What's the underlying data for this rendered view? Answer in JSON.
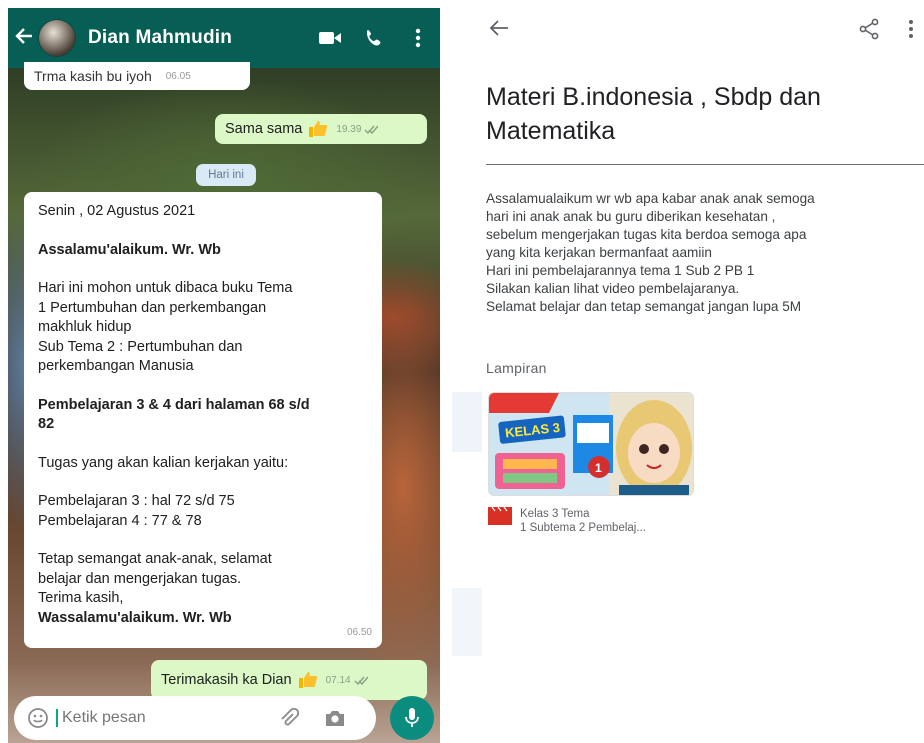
{
  "chat": {
    "contact_name": "Dian Mahmudin",
    "prev_message": {
      "text": "Trma kasih bu iyoh",
      "time": "06.05"
    },
    "sent_sama": {
      "text": "Sama sama",
      "time": "19.39"
    },
    "date_pill": "Hari ini",
    "main_message": {
      "date_line": "Senin ,  02 Agustus 2021",
      "greeting": "Assalamu'alaikum. Wr. Wb",
      "para1": [
        "Hari ini mohon untuk dibaca buku Tema",
        "1 Pertumbuhan dan perkembangan",
        "makhluk hidup",
        "Sub Tema 2 : Pertumbuhan dan",
        "perkembangan Manusia"
      ],
      "lesson": [
        "Pembelajaran 3 & 4 dari halaman 68 s/d",
        "82"
      ],
      "task_intro": "Tugas yang akan kalian kerjakan yaitu:",
      "tasks": [
        "Pembelajaran 3 : hal 72 s/d 75",
        "Pembelajaran 4 : 77 & 78"
      ],
      "closing": [
        "Tetap semangat anak-anak, selamat",
        "belajar dan mengerjakan tugas.",
        "Terima kasih,"
      ],
      "signoff": "Wassalamu'alaikum. Wr. Wb",
      "time": "06.50"
    },
    "sent_thanks": {
      "text": "Terimakasih ka Dian",
      "time": "07.14"
    },
    "input_placeholder": "Ketik pesan",
    "colors": {
      "header": "#075e54",
      "outgoing": "#dcf8c6",
      "mic": "#0a8d7f"
    }
  },
  "material": {
    "title": "Materi B.indonesia , Sbdp dan Matematika",
    "description": [
      "Assalamualaikum wr wb apa kabar anak anak semoga",
      "hari ini anak anak bu guru diberikan kesehatan ,",
      "sebelum mengerjakan tugas kita berdoa semoga apa",
      "yang kita kerjakan bermanfaat aamiin",
      "Hari ini pembelajarannya tema 1 Sub 2 PB 1",
      "Silakan kalian lihat video pembelajaranya.",
      "Selamat belajar dan tetap semangat jangan lupa 5M"
    ],
    "attachments_label": "Lampiran",
    "attachment": {
      "thumb_title": "KELAS 3",
      "thumb_badge": "1",
      "name_line1": "Kelas 3 Tema",
      "name_line2": "1 Subtema 2 Pembelaj..."
    }
  }
}
